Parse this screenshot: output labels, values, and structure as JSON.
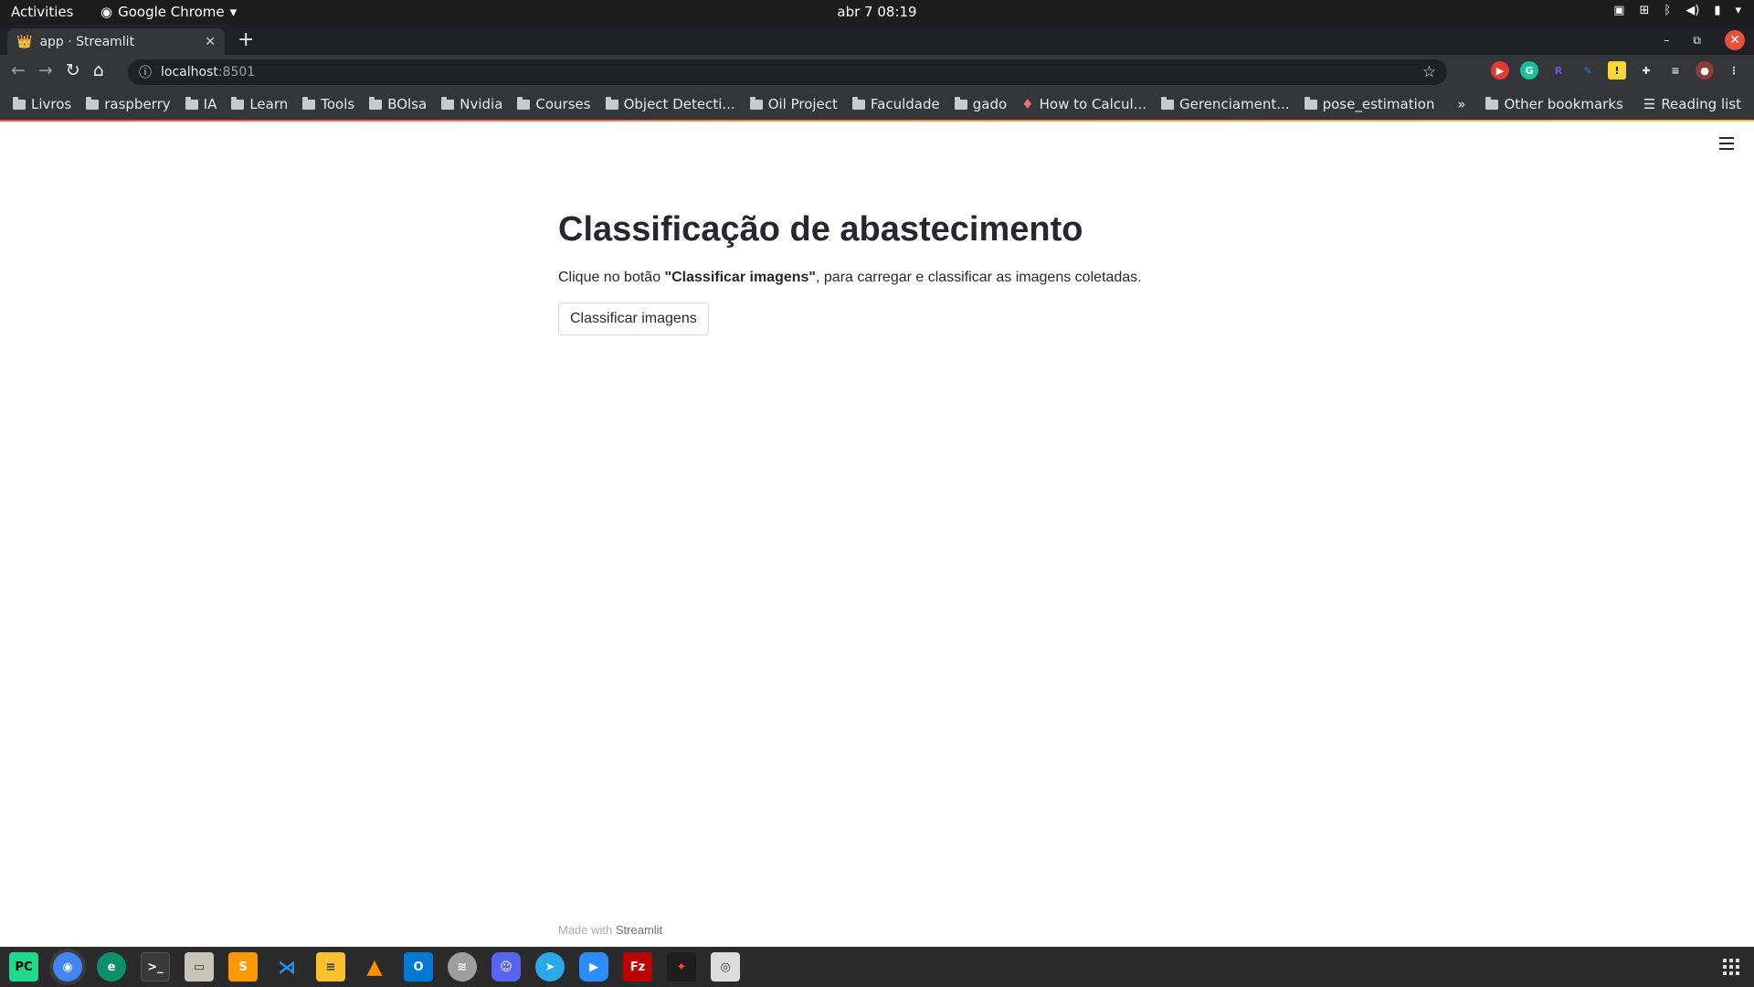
{
  "system": {
    "activities": "Activities",
    "app_name": "Google Chrome",
    "clock": "abr 7  08:19"
  },
  "browser": {
    "tab_title": "app · Streamlit",
    "url_host": "localhost",
    "url_port": ":8501",
    "bookmarks": [
      "Livros",
      "raspberry",
      "IA",
      "Learn",
      "Tools",
      "BOlsa",
      "Nvidia",
      "Courses",
      "Object Detecti...",
      "Oil Project",
      "Faculdade",
      "gado",
      "How to Calcul...",
      "Gerenciament...",
      "pose_estimation"
    ],
    "overflow": "»",
    "other_bookmarks": "Other bookmarks",
    "reading_list": "Reading list"
  },
  "page": {
    "title": "Classificação de abastecimento",
    "description_prefix": "Clique no botão ",
    "description_bold": "\"Classificar imagens\"",
    "description_suffix": ", para carregar e classificar as imagens coletadas.",
    "button_label": "Classificar imagens",
    "footer_prefix": "Made with ",
    "footer_link": "Streamlit"
  },
  "colors": {
    "accent_start": "#ff4b4b",
    "accent_end": "#ffbd45",
    "text": "#262730"
  }
}
